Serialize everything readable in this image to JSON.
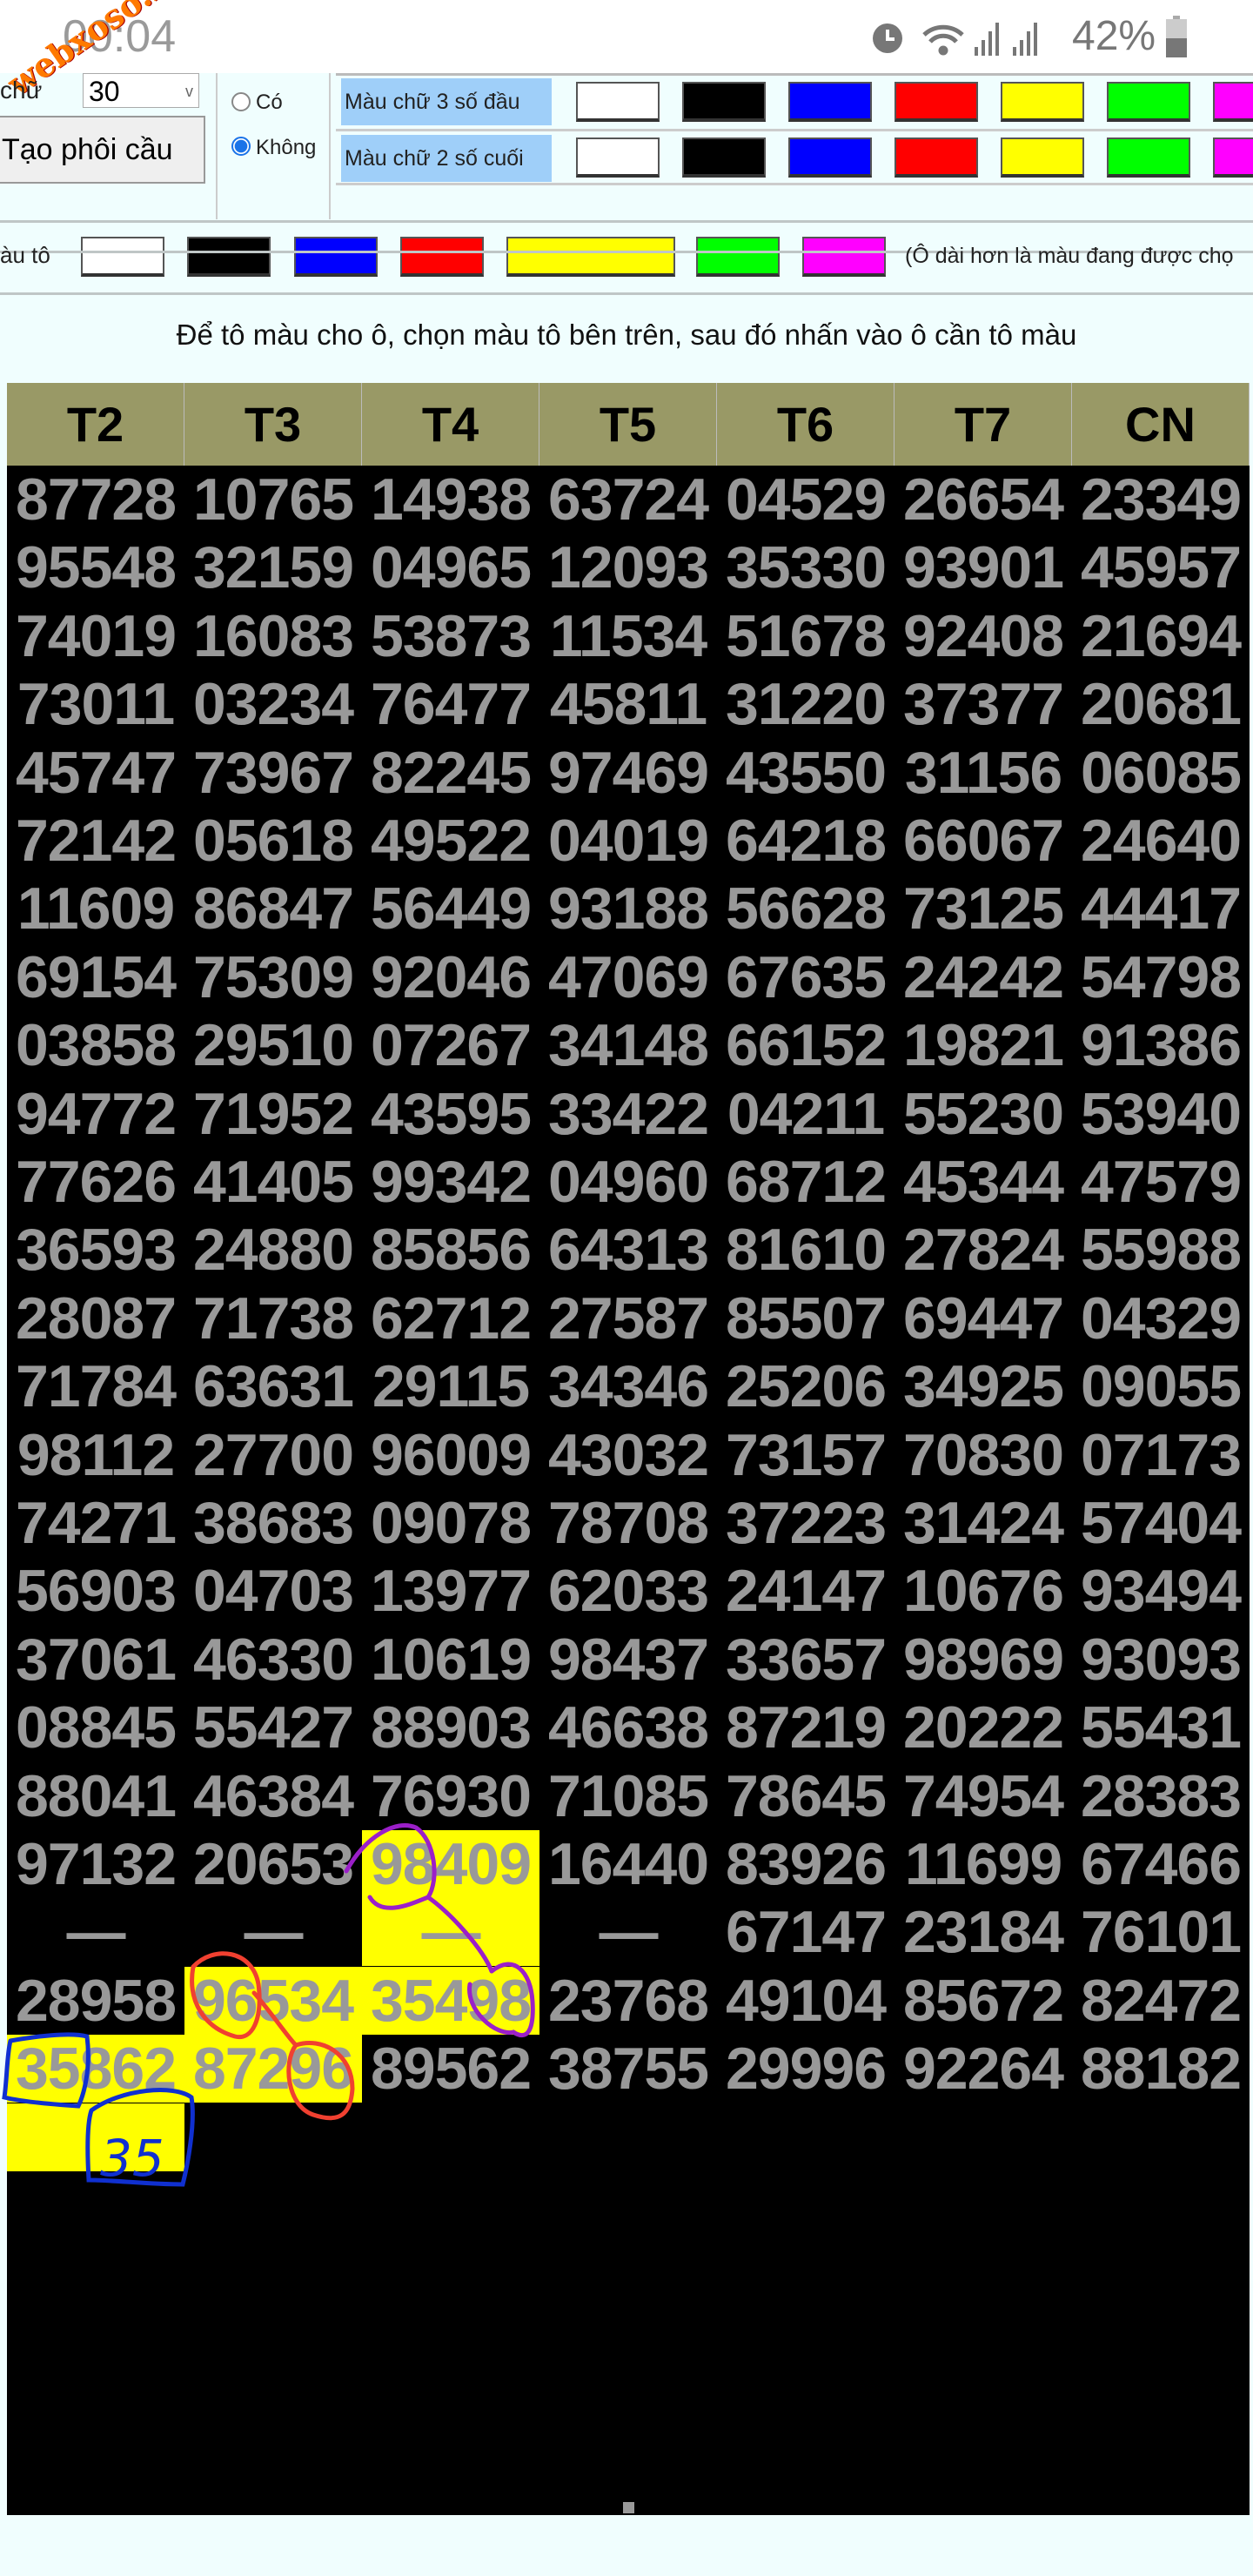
{
  "status_bar": {
    "time": "00:04",
    "battery": "42%",
    "watermark": "webxoso.net",
    "icons": [
      "alarm-icon",
      "wifi-icon",
      "signal-icon",
      "signal-icon",
      "battery-icon"
    ]
  },
  "controls": {
    "label_partial": "chữ",
    "select_value": "30",
    "create_button": "Tạo phôi cầu",
    "radio_yes": "Có",
    "radio_no": "Không",
    "radio_selected": "Không",
    "text_color_3_label": "Màu chữ 3 số đầu",
    "text_color_2_label": "Màu chữ 2 số cuối",
    "fill_label_partial": "àu tô",
    "fill_note": "(Ô dài hơn là màu đang được chọ",
    "swatches": [
      "#ffffff",
      "#000000",
      "#0000ff",
      "#ff0000",
      "#ffff00",
      "#00ff00",
      "#ff00ff"
    ],
    "selected_fill": "#ffff00"
  },
  "instruction": "Để tô màu cho ô, chọn màu tô bên trên, sau đó nhấn vào ô cần tô màu",
  "table": {
    "headers": [
      "T2",
      "T3",
      "T4",
      "T5",
      "T6",
      "T7",
      "CN"
    ],
    "rows": [
      [
        "87728",
        "10765",
        "14938",
        "63724",
        "04529",
        "26654",
        "23349"
      ],
      [
        "95548",
        "32159",
        "04965",
        "12093",
        "35330",
        "93901",
        "45957"
      ],
      [
        "74019",
        "16083",
        "53873",
        "11534",
        "51678",
        "92408",
        "21694"
      ],
      [
        "73011",
        "03234",
        "76477",
        "45811",
        "31220",
        "37377",
        "20681"
      ],
      [
        "45747",
        "73967",
        "82245",
        "97469",
        "43550",
        "31156",
        "06085"
      ],
      [
        "72142",
        "05618",
        "49522",
        "04019",
        "64218",
        "66067",
        "24640"
      ],
      [
        "11609",
        "86847",
        "56449",
        "93188",
        "56628",
        "73125",
        "44417"
      ],
      [
        "69154",
        "75309",
        "92046",
        "47069",
        "67635",
        "24242",
        "54798"
      ],
      [
        "03858",
        "29510",
        "07267",
        "34148",
        "66152",
        "19821",
        "91386"
      ],
      [
        "94772",
        "71952",
        "43595",
        "33422",
        "04211",
        "55230",
        "53940"
      ],
      [
        "77626",
        "41405",
        "99342",
        "04960",
        "68712",
        "45344",
        "47579"
      ],
      [
        "36593",
        "24880",
        "85856",
        "64313",
        "81610",
        "27824",
        "55988"
      ],
      [
        "28087",
        "71738",
        "62712",
        "27587",
        "85507",
        "69447",
        "04329"
      ],
      [
        "71784",
        "63631",
        "29115",
        "34346",
        "25206",
        "34925",
        "09055"
      ],
      [
        "98112",
        "27700",
        "96009",
        "43032",
        "73157",
        "70830",
        "07173"
      ],
      [
        "74271",
        "38683",
        "09078",
        "78708",
        "37223",
        "31424",
        "57404"
      ],
      [
        "56903",
        "04703",
        "13977",
        "62033",
        "24147",
        "10676",
        "93494"
      ],
      [
        "37061",
        "46330",
        "10619",
        "98437",
        "33657",
        "98969",
        "93093"
      ],
      [
        "08845",
        "55427",
        "88903",
        "46638",
        "87219",
        "20222",
        "55431"
      ],
      [
        "88041",
        "46384",
        "76930",
        "71085",
        "78645",
        "74954",
        "28383"
      ],
      [
        "97132",
        "20653",
        "98409",
        "16440",
        "83926",
        "11699",
        "67466"
      ],
      [
        "—",
        "—",
        "—",
        "—",
        "67147",
        "23184",
        "76101"
      ],
      [
        "28958",
        "96534",
        "35498",
        "23768",
        "49104",
        "85672",
        "82472"
      ],
      [
        "35862",
        "87296",
        "89562",
        "38755",
        "29996",
        "92264",
        "88182"
      ],
      [
        "",
        "",
        "",
        "",
        "",
        "",
        ""
      ]
    ],
    "highlighted_cells": [
      [
        20,
        2
      ],
      [
        21,
        2
      ],
      [
        22,
        1
      ],
      [
        22,
        2
      ],
      [
        23,
        0
      ],
      [
        23,
        1
      ],
      [
        24,
        0
      ]
    ],
    "highlight_color": "#ffff00",
    "footer_mark": "-"
  },
  "annotations": {
    "handwritten_text": "35",
    "colors": [
      "#9b1fc9",
      "#f04030",
      "#1030d0"
    ]
  }
}
